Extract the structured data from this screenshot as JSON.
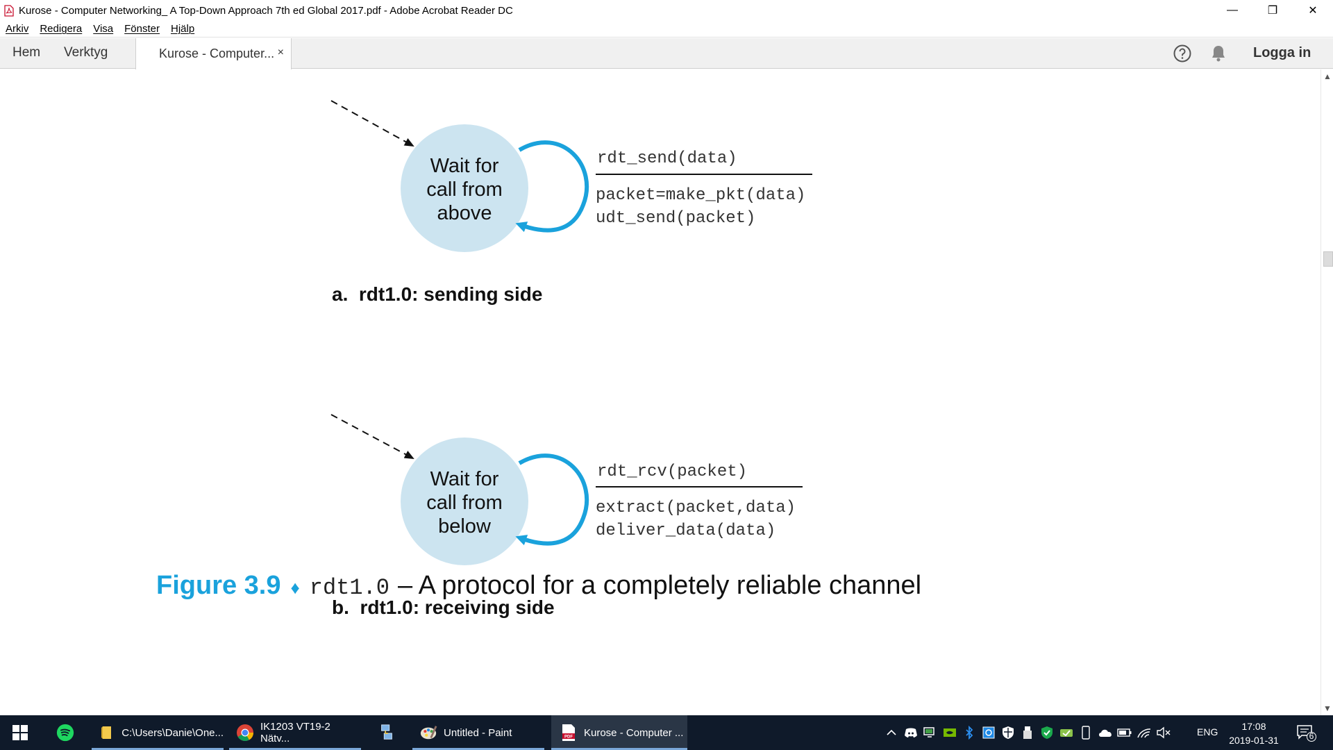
{
  "window": {
    "title": "Kurose - Computer Networking_ A Top-Down Approach 7th ed Global 2017.pdf - Adobe Acrobat Reader DC",
    "minimize": "—",
    "restore": "❐",
    "close": "✕"
  },
  "menu": {
    "items": [
      "Arkiv",
      "Redigera",
      "Visa",
      "Fönster",
      "Hjälp"
    ]
  },
  "tabs": {
    "home": "Hem",
    "tools": "Verktyg",
    "document": "Kurose - Computer...",
    "close": "×",
    "login": "Logga in"
  },
  "figure": {
    "sender": {
      "state_lines": [
        "Wait for",
        "call from",
        "above"
      ],
      "event": "rdt_send(data)",
      "actions": [
        "packet=make_pkt(data)",
        "udt_send(packet)"
      ],
      "caption": "a.  rdt1.0: sending side"
    },
    "receiver": {
      "state_lines": [
        "Wait for",
        "call from",
        "below"
      ],
      "event": "rdt_rcv(packet)",
      "actions": [
        "extract(packet,data)",
        "deliver_data(data)"
      ],
      "caption": "b.  rdt1.0: receiving side"
    },
    "caption": {
      "number": "Figure 3.9",
      "diamond": "♦",
      "mono": "rdt1.0",
      "text": "– A protocol for a completely reliable channel"
    },
    "colors": {
      "state_fill": "#cce4f0",
      "loop_arrow": "#1aa2dc",
      "caption_accent": "#1aa2dc"
    }
  },
  "taskbar": {
    "items": [
      {
        "label": "C:\\Users\\Danie\\One...",
        "icon": "folder-icon"
      },
      {
        "label": "IK1203 VT19-2 Nätv...",
        "icon": "chrome-icon"
      },
      {
        "label": "Untitled - Paint",
        "icon": "paint-icon"
      },
      {
        "label": "Kurose - Computer ...",
        "icon": "acrobat-icon"
      }
    ],
    "language": "ENG",
    "time": "17:08",
    "date": "2019-01-31",
    "notification_count": "6"
  }
}
